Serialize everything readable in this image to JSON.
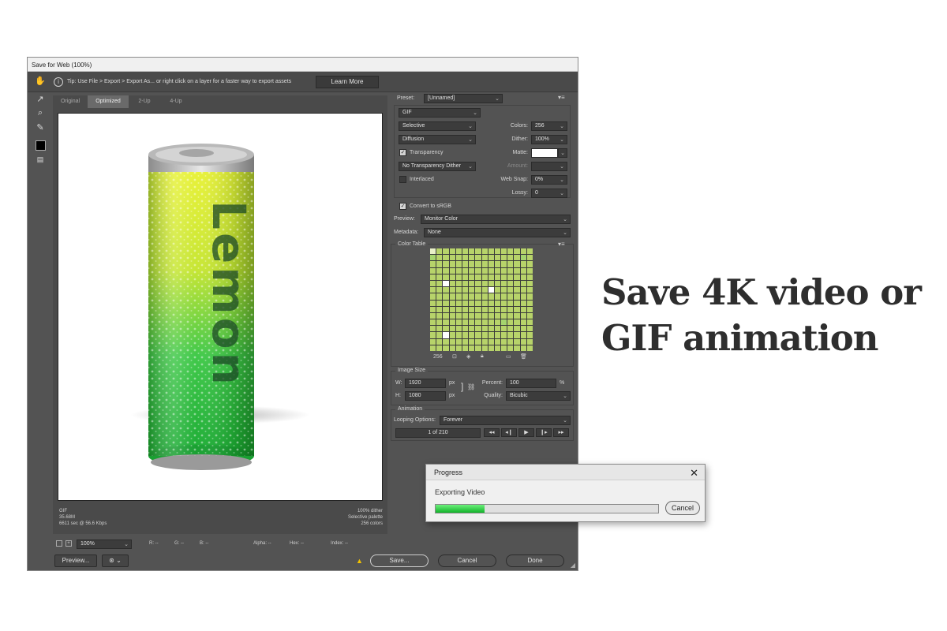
{
  "window": {
    "title": "Save for Web (100%)",
    "tip": "Tip: Use File > Export > Export As... or right click on a layer for a faster way to export assets",
    "learn_more": "Learn More"
  },
  "tabs": [
    "Original",
    "Optimized",
    "2-Up",
    "4-Up"
  ],
  "active_tab": "Optimized",
  "image": {
    "can_text": "Lemon",
    "info_left": [
      "GIF",
      "35.68M",
      "6611 sec @ 56.6 Kbps"
    ],
    "info_right": [
      "100% dither",
      "Selective palette",
      "256 colors"
    ]
  },
  "statusbar": {
    "zoom": "100%",
    "r": "R: --",
    "g": "G: --",
    "b": "B: --",
    "alpha": "Alpha: --",
    "hex": "Hex: --",
    "index": "Index: --"
  },
  "bottom": {
    "preview": "Preview...",
    "save": "Save...",
    "cancel": "Cancel",
    "done": "Done",
    "warning_icon": "warning-icon"
  },
  "settings": {
    "preset_label": "Preset:",
    "preset_value": "[Unnamed]",
    "format": "GIF",
    "reduction": "Selective",
    "dither_algo": "Diffusion",
    "transparency_label": "Transparency",
    "transparency_checked": true,
    "trans_dither": "No Transparency Dither",
    "interlaced_label": "Interlaced",
    "interlaced_checked": false,
    "colors_label": "Colors:",
    "colors_value": "256",
    "dither_label": "Dither:",
    "dither_value": "100%",
    "matte_label": "Matte:",
    "amount_label": "Amount:",
    "websnap_label": "Web Snap:",
    "websnap_value": "0%",
    "lossy_label": "Lossy:",
    "lossy_value": "0",
    "convert_label": "Convert to sRGB",
    "convert_checked": true,
    "preview_label": "Preview:",
    "preview_value": "Monitor Color",
    "metadata_label": "Metadata:",
    "metadata_value": "None"
  },
  "color_table": {
    "title": "Color Table",
    "count": "256",
    "palette": [
      "#b7d36a",
      "#6fbf5a",
      "#d9e89a",
      "#4f9e3e",
      "#e8f0c8",
      "#9cc86a",
      "#3d7a33",
      "#c8dc84",
      "#a5d46e",
      "#ffffff",
      "#5aa94a",
      "#e3ebb3",
      "#8bbf4f",
      "#2f6a2a",
      "#cfe18f",
      "#b0b0b0"
    ]
  },
  "image_size": {
    "title": "Image Size",
    "w_label": "W:",
    "w_value": "1920",
    "w_unit": "px",
    "h_label": "H:",
    "h_value": "1080",
    "h_unit": "px",
    "percent_label": "Percent:",
    "percent_value": "100",
    "percent_unit": "%",
    "quality_label": "Quality:",
    "quality_value": "Bicubic"
  },
  "animation": {
    "title": "Animation",
    "looping_label": "Looping Options:",
    "looping_value": "Forever",
    "frame": "1 of 210"
  },
  "progress": {
    "title": "Progress",
    "text": "Exporting Video",
    "cancel": "Cancel",
    "fraction": 0.22
  },
  "headline": "Save 4K video or GIF animation"
}
